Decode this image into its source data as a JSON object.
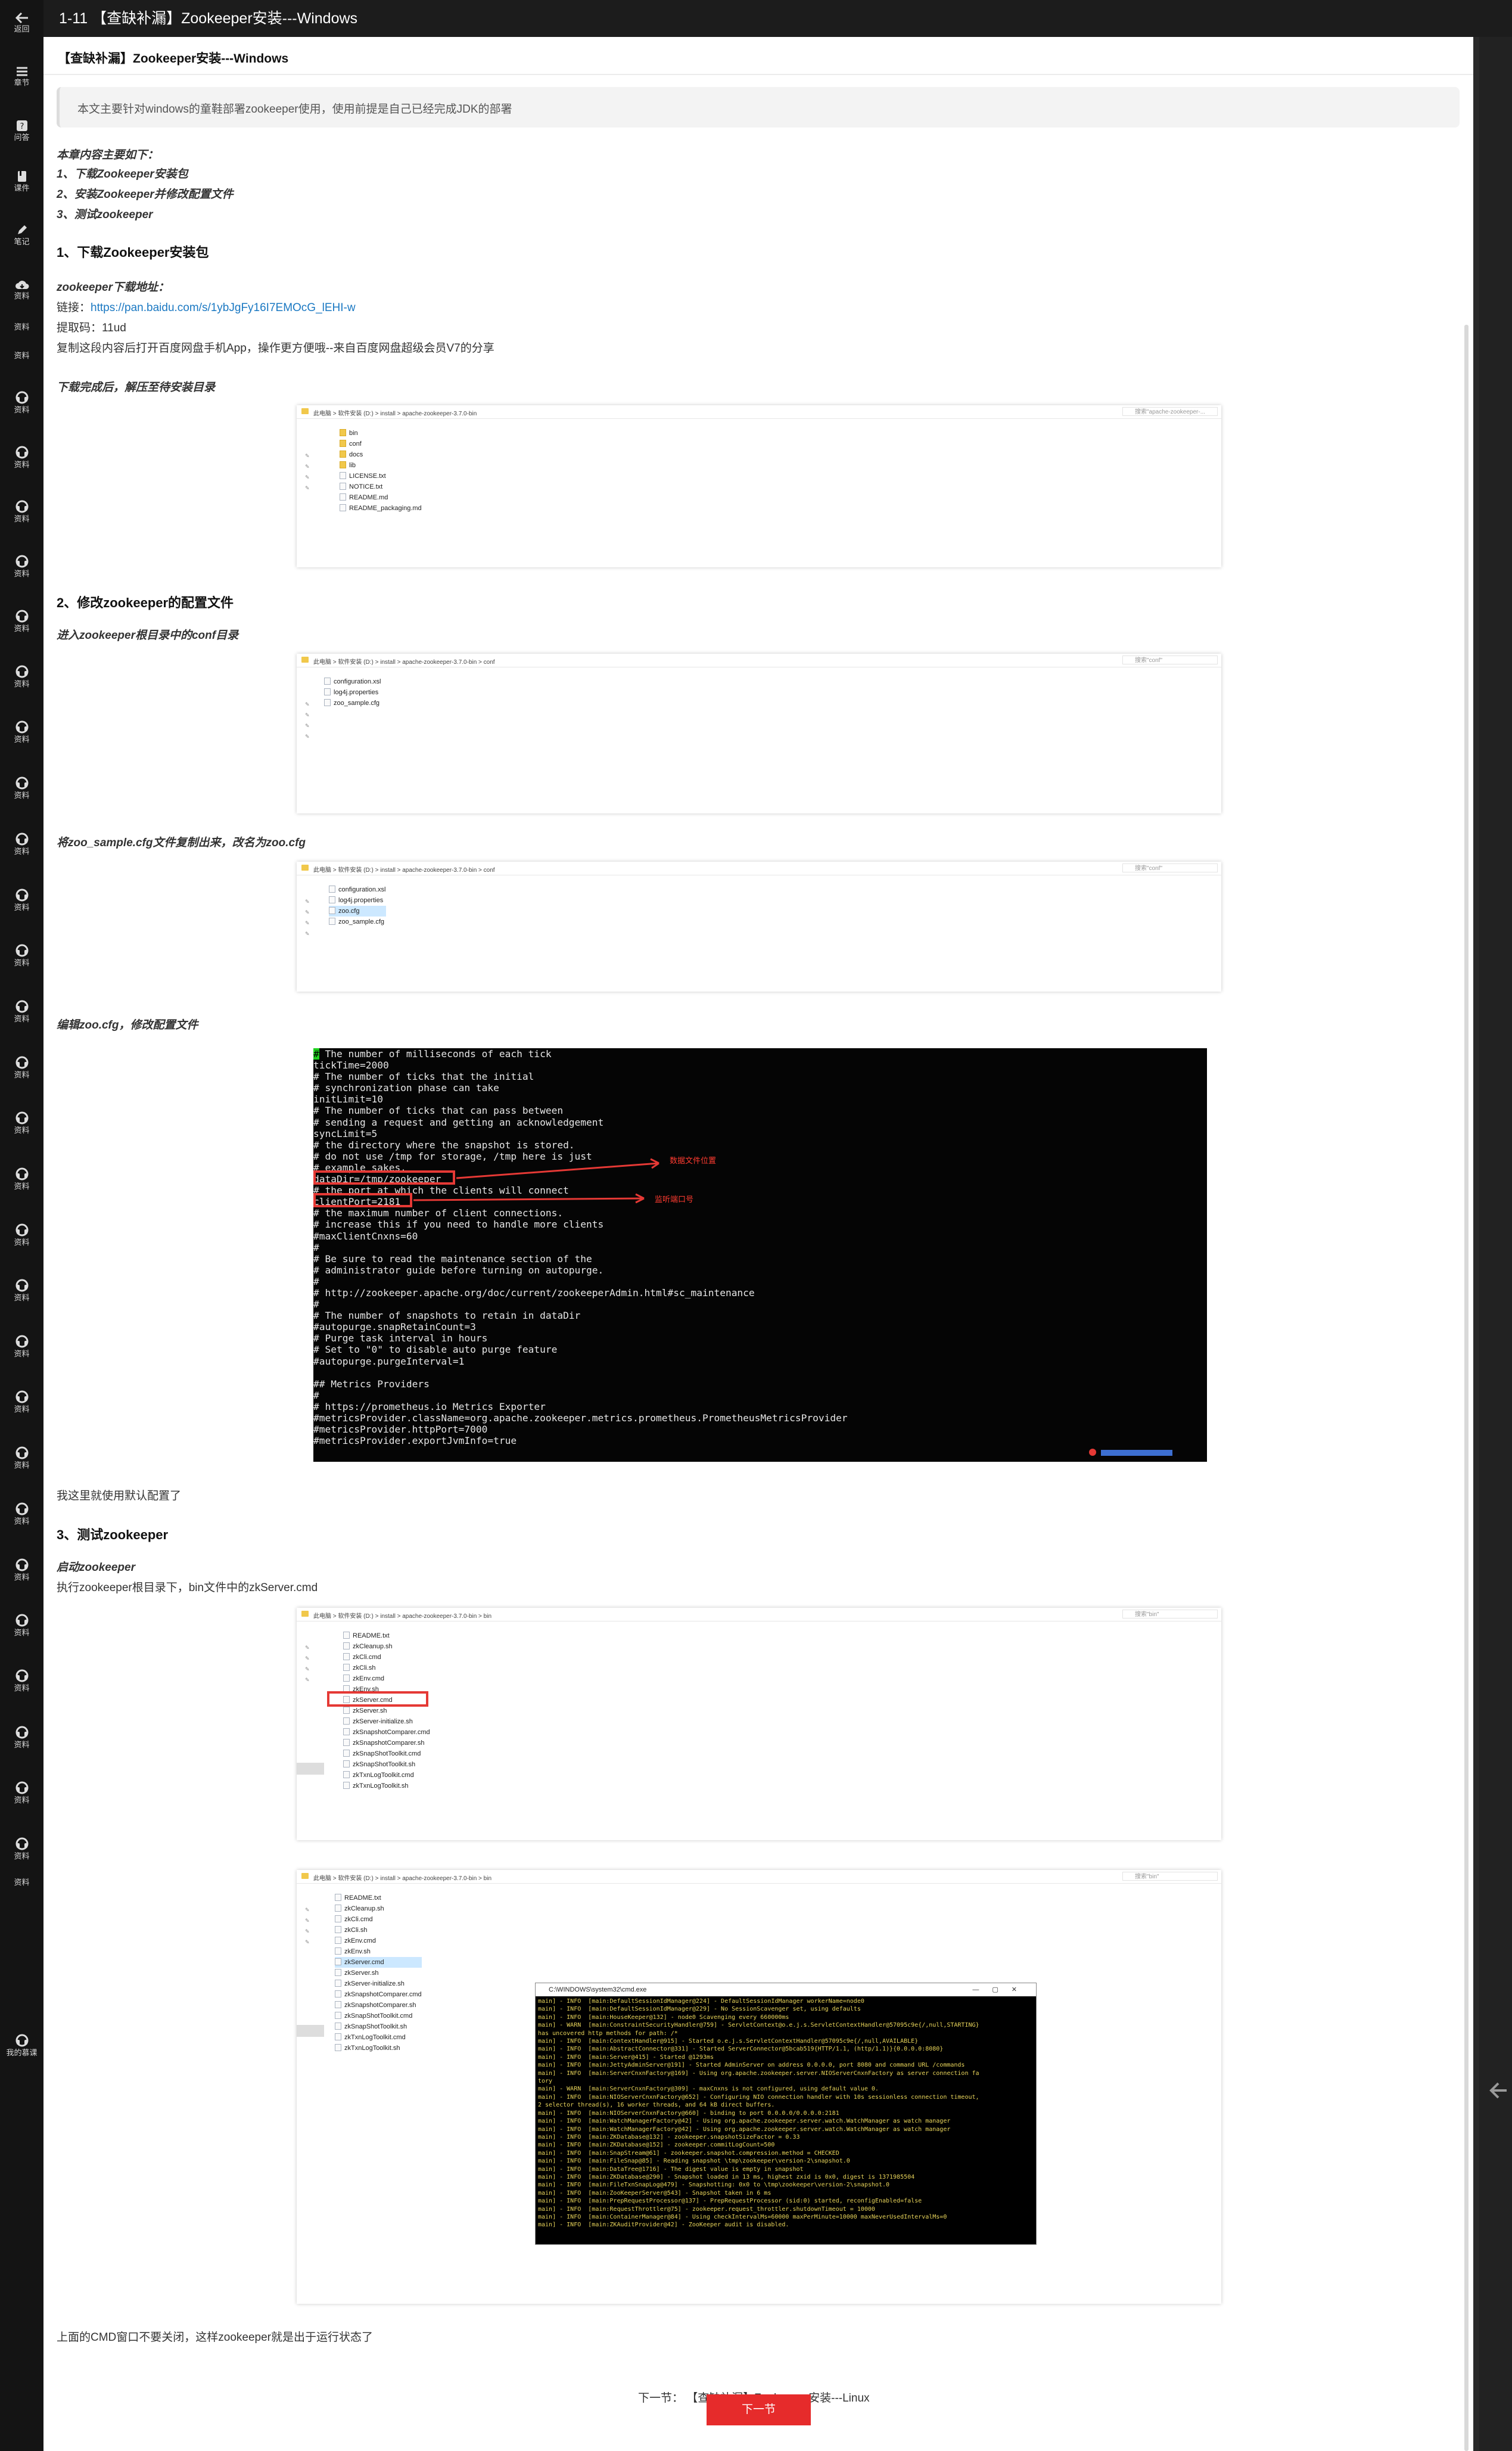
{
  "app": {
    "back_label": "返回",
    "title": "1-11 【查缺补漏】Zookeeper安装---Windows"
  },
  "rail": {
    "items": [
      {
        "label": "章节",
        "icon": "menu-icon"
      },
      {
        "label": "问答",
        "icon": "question-icon"
      },
      {
        "label": "课件",
        "icon": "courseware-icon"
      },
      {
        "label": "笔记",
        "icon": "pencil-icon"
      },
      {
        "label": "资料",
        "icon": "cloud-download-icon"
      },
      {
        "label": "资料",
        "icon": "none"
      },
      {
        "label": "资料",
        "icon": "none"
      },
      {
        "label": "资料",
        "icon": "headset-icon"
      },
      {
        "label": "资料",
        "icon": "headset-icon"
      },
      {
        "label": "资料",
        "icon": "headset-icon"
      },
      {
        "label": "资料",
        "icon": "headset-icon"
      },
      {
        "label": "资料",
        "icon": "headset-icon"
      },
      {
        "label": "资料",
        "icon": "headset-icon"
      },
      {
        "label": "资料",
        "icon": "headset-icon"
      },
      {
        "label": "资料",
        "icon": "headset-icon"
      },
      {
        "label": "资料",
        "icon": "headset-icon"
      },
      {
        "label": "资料",
        "icon": "headset-icon"
      },
      {
        "label": "资料",
        "icon": "headset-icon"
      },
      {
        "label": "资料",
        "icon": "headset-icon"
      },
      {
        "label": "资料",
        "icon": "headset-icon"
      },
      {
        "label": "资料",
        "icon": "headset-icon"
      },
      {
        "label": "资料",
        "icon": "headset-icon"
      },
      {
        "label": "资料",
        "icon": "headset-icon"
      },
      {
        "label": "资料",
        "icon": "headset-icon"
      },
      {
        "label": "资料",
        "icon": "headset-icon"
      },
      {
        "label": "资料",
        "icon": "headset-icon"
      },
      {
        "label": "资料",
        "icon": "headset-icon"
      },
      {
        "label": "资料",
        "icon": "headset-icon"
      },
      {
        "label": "资料",
        "icon": "headset-icon"
      },
      {
        "label": "资料",
        "icon": "headset-icon"
      },
      {
        "label": "资料",
        "icon": "headset-icon"
      },
      {
        "label": "资料",
        "icon": "headset-icon"
      },
      {
        "label": "资料",
        "icon": "headset-icon"
      },
      {
        "label": "资料",
        "icon": "headset-icon"
      },
      {
        "label": "资料",
        "icon": "none"
      },
      {
        "label": "我的慕课",
        "icon": "headset-icon"
      }
    ]
  },
  "article": {
    "heading": "【查缺补漏】Zookeeper安装---Windows",
    "intro": "本文主要针对windows的童鞋部署zookeeper使用，使用前提是自己已经完成JDK的部署",
    "toc_title": "本章内容主要如下：",
    "toc": [
      "1、下载Zookeeper安装包",
      "2、安装Zookeeper并修改配置文件",
      "3、测试zookeeper"
    ],
    "s1_title": "1、下载Zookeeper安装包",
    "dl_label": "zookeeper下载地址：",
    "link_prefix": "链接：",
    "link_url": "https://pan.baidu.com/s/1ybJgFy16I7EMOcG_lEHI-w",
    "code_line": "提取码：11ud",
    "share_line": "复制这段内容后打开百度网盘手机App，操作更方便哦--来自百度网盘超级会员V7的分享",
    "after_dl": "下载完成后，解压至待安装目录",
    "s2_title": "2、修改zookeeper的配置文件",
    "conf_dir": "进入zookeeper根目录中的conf目录",
    "copy_cfg": "将zoo_sample.cfg文件复制出来，改名为zoo.cfg",
    "edit_cfg": "编辑zoo.cfg，修改配置文件",
    "default_cfg": "我这里就使用默认配置了",
    "s3_title": "3、测试zookeeper",
    "start_label": "启动zookeeper",
    "run_line": "执行zookeeper根目录下，bin文件中的zkServer.cmd",
    "close_note": "上面的CMD窗口不要关闭，这样zookeeper就是出于运行状态了",
    "prev_next": "下一节： 【查缺补漏】Zookeeper安装---Linux",
    "next_button": "下一节"
  },
  "explorer": {
    "search_placeholder_root": "搜索\"apache-zookeeper-...",
    "search_placeholder_conf": "搜索\"conf\"",
    "search_placeholder_bin": "搜索\"bin\"",
    "crumbs_root": "此电脑  >  软件安装 (D:)  >  install  >  apache-zookeeper-3.7.0-bin",
    "crumbs_conf": "此电脑  >  软件安装 (D:)  >  install  >  apache-zookeeper-3.7.0-bin  >  conf",
    "crumbs_bin": "此电脑  >  软件安装 (D:)  >  install  >  apache-zookeeper-3.7.0-bin  >  bin",
    "root_files": [
      "bin",
      "conf",
      "docs",
      "lib",
      "LICENSE.txt",
      "NOTICE.txt",
      "README.md",
      "README_packaging.md"
    ],
    "conf_files": [
      "configuration.xsl",
      "log4j.properties",
      "zoo_sample.cfg"
    ],
    "conf_files2": [
      "configuration.xsl",
      "log4j.properties",
      "zoo.cfg",
      "zoo_sample.cfg"
    ],
    "bin_files": [
      "README.txt",
      "zkCleanup.sh",
      "zkCli.cmd",
      "zkCli.sh",
      "zkEnv.cmd",
      "zkEnv.sh",
      "zkServer.cmd",
      "zkServer.sh",
      "zkServer-initialize.sh",
      "zkSnapshotComparer.cmd",
      "zkSnapshotComparer.sh",
      "zkSnapShotToolkit.cmd",
      "zkSnapShotToolkit.sh",
      "zkTxnLogToolkit.cmd",
      "zkTxnLogToolkit.sh"
    ]
  },
  "terminal": {
    "lines": [
      "# The number of milliseconds of each tick",
      "tickTime=2000",
      "# The number of ticks that the initial",
      "# synchronization phase can take",
      "initLimit=10",
      "# The number of ticks that can pass between",
      "# sending a request and getting an acknowledgement",
      "syncLimit=5",
      "# the directory where the snapshot is stored.",
      "# do not use /tmp for storage, /tmp here is just",
      "# example sakes.",
      "dataDir=/tmp/zookeeper",
      "# the port at which the clients will connect",
      "clientPort=2181",
      "# the maximum number of client connections.",
      "# increase this if you need to handle more clients",
      "#maxClientCnxns=60",
      "#",
      "# Be sure to read the maintenance section of the",
      "# administrator guide before turning on autopurge.",
      "#",
      "# http://zookeeper.apache.org/doc/current/zookeeperAdmin.html#sc_maintenance",
      "#",
      "# The number of snapshots to retain in dataDir",
      "#autopurge.snapRetainCount=3",
      "# Purge task interval in hours",
      "# Set to \"0\" to disable auto purge feature",
      "#autopurge.purgeInterval=1",
      "",
      "## Metrics Providers",
      "#",
      "# https://prometheus.io Metrics Exporter",
      "#metricsProvider.className=org.apache.zookeeper.metrics.prometheus.PrometheusMetricsProvider",
      "#metricsProvider.httpPort=7000",
      "#metricsProvider.exportJvmInfo=true"
    ],
    "anno_data": "数据文件位置",
    "anno_port": "监听端口号"
  },
  "cmd": {
    "title": "C:\\WINDOWS\\system32\\cmd.exe",
    "lines": [
      "main] - INFO  [main:DefaultSessionIdManager@224] - DefaultSessionIdManager workerName=node0",
      "main] - INFO  [main:DefaultSessionIdManager@229] - No SessionScavenger set, using defaults",
      "main] - INFO  [main:HouseKeeper@132] - node0 Scavenging every 660000ms",
      "main] - WARN  [main:ConstraintSecurityHandler@759] - ServletContext@o.e.j.s.ServletContextHandler@57095c9e{/,null,STARTING}",
      "has uncovered http methods for path: /*",
      "main] - INFO  [main:ContextHandler@915] - Started o.e.j.s.ServletContextHandler@57095c9e{/,null,AVAILABLE}",
      "main] - INFO  [main:AbstractConnector@331] - Started ServerConnector@5bcab519{HTTP/1.1, (http/1.1)}{0.0.0.0:8080}",
      "main] - INFO  [main:Server@415] - Started @1293ms",
      "main] - INFO  [main:JettyAdminServer@191] - Started AdminServer on address 0.0.0.0, port 8080 and command URL /commands",
      "main] - INFO  [main:ServerCnxnFactory@169] - Using org.apache.zookeeper.server.NIOServerCnxnFactory as server connection fa",
      "tory",
      "main] - WARN  [main:ServerCnxnFactory@309] - maxCnxns is not configured, using default value 0.",
      "main] - INFO  [main:NIOServerCnxnFactory@652] - Configuring NIO connection handler with 10s sessionless connection timeout,",
      "2 selector thread(s), 16 worker threads, and 64 kB direct buffers.",
      "main] - INFO  [main:NIOServerCnxnFactory@660] - binding to port 0.0.0.0/0.0.0.0:2181",
      "main] - INFO  [main:WatchManagerFactory@42] - Using org.apache.zookeeper.server.watch.WatchManager as watch manager",
      "main] - INFO  [main:WatchManagerFactory@42] - Using org.apache.zookeeper.server.watch.WatchManager as watch manager",
      "main] - INFO  [main:ZKDatabase@132] - zookeeper.snapshotSizeFactor = 0.33",
      "main] - INFO  [main:ZKDatabase@152] - zookeeper.commitLogCount=500",
      "main] - INFO  [main:SnapStream@61] - zookeeper.snapshot.compression.method = CHECKED",
      "main] - INFO  [main:FileSnap@85] - Reading snapshot \\tmp\\zookeeper\\version-2\\snapshot.0",
      "main] - INFO  [main:DataTree@1716] - The digest value is empty in snapshot",
      "main] - INFO  [main:ZKDatabase@290] - Snapshot loaded in 13 ms, highest zxid is 0x0, digest is 1371985504",
      "main] - INFO  [main:FileTxnSnapLog@479] - Snapshotting: 0x0 to \\tmp\\zookeeper\\version-2\\snapshot.0",
      "main] - INFO  [main:ZooKeeperServer@543] - Snapshot taken in 6 ms",
      "main] - INFO  [main:PrepRequestProcessor@137] - PrepRequestProcessor (sid:0) started, reconfigEnabled=false",
      "main] - INFO  [main:RequestThrottler@75] - zookeeper.request_throttler.shutdownTimeout = 10000",
      "main] - INFO  [main:ContainerManager@84] - Using checkIntervalMs=60000 maxPerMinute=10000 maxNeverUsedIntervalMs=0",
      "main] - INFO  [main:ZKAuditProvider@42] - ZooKeeper audit is disabled."
    ]
  },
  "colors": {
    "accent_red": "#e62b2b",
    "link_blue": "#1a78c2",
    "cmd_text": "#e8d45a"
  }
}
